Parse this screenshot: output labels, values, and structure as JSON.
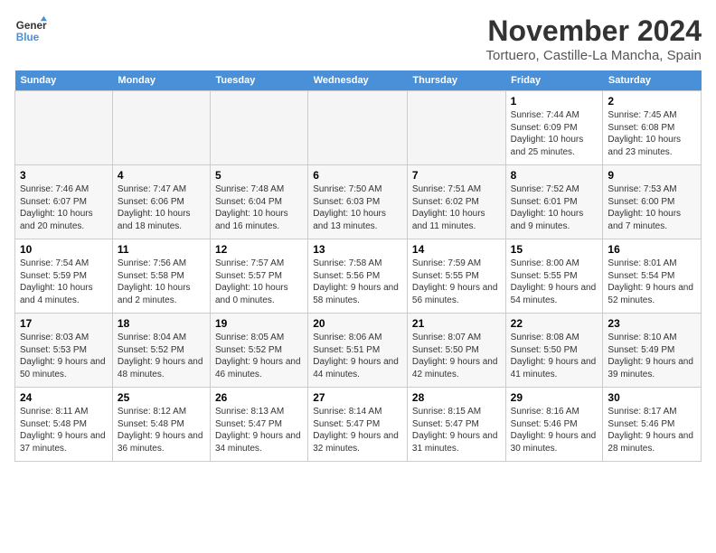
{
  "logo": {
    "text_general": "General",
    "text_blue": "Blue"
  },
  "header": {
    "month": "November 2024",
    "location": "Tortuero, Castille-La Mancha, Spain"
  },
  "weekdays": [
    "Sunday",
    "Monday",
    "Tuesday",
    "Wednesday",
    "Thursday",
    "Friday",
    "Saturday"
  ],
  "weeks": [
    [
      {
        "day": "",
        "empty": true
      },
      {
        "day": "",
        "empty": true
      },
      {
        "day": "",
        "empty": true
      },
      {
        "day": "",
        "empty": true
      },
      {
        "day": "",
        "empty": true
      },
      {
        "day": "1",
        "sunrise": "Sunrise: 7:44 AM",
        "sunset": "Sunset: 6:09 PM",
        "daylight": "Daylight: 10 hours and 25 minutes."
      },
      {
        "day": "2",
        "sunrise": "Sunrise: 7:45 AM",
        "sunset": "Sunset: 6:08 PM",
        "daylight": "Daylight: 10 hours and 23 minutes."
      }
    ],
    [
      {
        "day": "3",
        "sunrise": "Sunrise: 7:46 AM",
        "sunset": "Sunset: 6:07 PM",
        "daylight": "Daylight: 10 hours and 20 minutes."
      },
      {
        "day": "4",
        "sunrise": "Sunrise: 7:47 AM",
        "sunset": "Sunset: 6:06 PM",
        "daylight": "Daylight: 10 hours and 18 minutes."
      },
      {
        "day": "5",
        "sunrise": "Sunrise: 7:48 AM",
        "sunset": "Sunset: 6:04 PM",
        "daylight": "Daylight: 10 hours and 16 minutes."
      },
      {
        "day": "6",
        "sunrise": "Sunrise: 7:50 AM",
        "sunset": "Sunset: 6:03 PM",
        "daylight": "Daylight: 10 hours and 13 minutes."
      },
      {
        "day": "7",
        "sunrise": "Sunrise: 7:51 AM",
        "sunset": "Sunset: 6:02 PM",
        "daylight": "Daylight: 10 hours and 11 minutes."
      },
      {
        "day": "8",
        "sunrise": "Sunrise: 7:52 AM",
        "sunset": "Sunset: 6:01 PM",
        "daylight": "Daylight: 10 hours and 9 minutes."
      },
      {
        "day": "9",
        "sunrise": "Sunrise: 7:53 AM",
        "sunset": "Sunset: 6:00 PM",
        "daylight": "Daylight: 10 hours and 7 minutes."
      }
    ],
    [
      {
        "day": "10",
        "sunrise": "Sunrise: 7:54 AM",
        "sunset": "Sunset: 5:59 PM",
        "daylight": "Daylight: 10 hours and 4 minutes."
      },
      {
        "day": "11",
        "sunrise": "Sunrise: 7:56 AM",
        "sunset": "Sunset: 5:58 PM",
        "daylight": "Daylight: 10 hours and 2 minutes."
      },
      {
        "day": "12",
        "sunrise": "Sunrise: 7:57 AM",
        "sunset": "Sunset: 5:57 PM",
        "daylight": "Daylight: 10 hours and 0 minutes."
      },
      {
        "day": "13",
        "sunrise": "Sunrise: 7:58 AM",
        "sunset": "Sunset: 5:56 PM",
        "daylight": "Daylight: 9 hours and 58 minutes."
      },
      {
        "day": "14",
        "sunrise": "Sunrise: 7:59 AM",
        "sunset": "Sunset: 5:55 PM",
        "daylight": "Daylight: 9 hours and 56 minutes."
      },
      {
        "day": "15",
        "sunrise": "Sunrise: 8:00 AM",
        "sunset": "Sunset: 5:55 PM",
        "daylight": "Daylight: 9 hours and 54 minutes."
      },
      {
        "day": "16",
        "sunrise": "Sunrise: 8:01 AM",
        "sunset": "Sunset: 5:54 PM",
        "daylight": "Daylight: 9 hours and 52 minutes."
      }
    ],
    [
      {
        "day": "17",
        "sunrise": "Sunrise: 8:03 AM",
        "sunset": "Sunset: 5:53 PM",
        "daylight": "Daylight: 9 hours and 50 minutes."
      },
      {
        "day": "18",
        "sunrise": "Sunrise: 8:04 AM",
        "sunset": "Sunset: 5:52 PM",
        "daylight": "Daylight: 9 hours and 48 minutes."
      },
      {
        "day": "19",
        "sunrise": "Sunrise: 8:05 AM",
        "sunset": "Sunset: 5:52 PM",
        "daylight": "Daylight: 9 hours and 46 minutes."
      },
      {
        "day": "20",
        "sunrise": "Sunrise: 8:06 AM",
        "sunset": "Sunset: 5:51 PM",
        "daylight": "Daylight: 9 hours and 44 minutes."
      },
      {
        "day": "21",
        "sunrise": "Sunrise: 8:07 AM",
        "sunset": "Sunset: 5:50 PM",
        "daylight": "Daylight: 9 hours and 42 minutes."
      },
      {
        "day": "22",
        "sunrise": "Sunrise: 8:08 AM",
        "sunset": "Sunset: 5:50 PM",
        "daylight": "Daylight: 9 hours and 41 minutes."
      },
      {
        "day": "23",
        "sunrise": "Sunrise: 8:10 AM",
        "sunset": "Sunset: 5:49 PM",
        "daylight": "Daylight: 9 hours and 39 minutes."
      }
    ],
    [
      {
        "day": "24",
        "sunrise": "Sunrise: 8:11 AM",
        "sunset": "Sunset: 5:48 PM",
        "daylight": "Daylight: 9 hours and 37 minutes."
      },
      {
        "day": "25",
        "sunrise": "Sunrise: 8:12 AM",
        "sunset": "Sunset: 5:48 PM",
        "daylight": "Daylight: 9 hours and 36 minutes."
      },
      {
        "day": "26",
        "sunrise": "Sunrise: 8:13 AM",
        "sunset": "Sunset: 5:47 PM",
        "daylight": "Daylight: 9 hours and 34 minutes."
      },
      {
        "day": "27",
        "sunrise": "Sunrise: 8:14 AM",
        "sunset": "Sunset: 5:47 PM",
        "daylight": "Daylight: 9 hours and 32 minutes."
      },
      {
        "day": "28",
        "sunrise": "Sunrise: 8:15 AM",
        "sunset": "Sunset: 5:47 PM",
        "daylight": "Daylight: 9 hours and 31 minutes."
      },
      {
        "day": "29",
        "sunrise": "Sunrise: 8:16 AM",
        "sunset": "Sunset: 5:46 PM",
        "daylight": "Daylight: 9 hours and 30 minutes."
      },
      {
        "day": "30",
        "sunrise": "Sunrise: 8:17 AM",
        "sunset": "Sunset: 5:46 PM",
        "daylight": "Daylight: 9 hours and 28 minutes."
      }
    ]
  ]
}
